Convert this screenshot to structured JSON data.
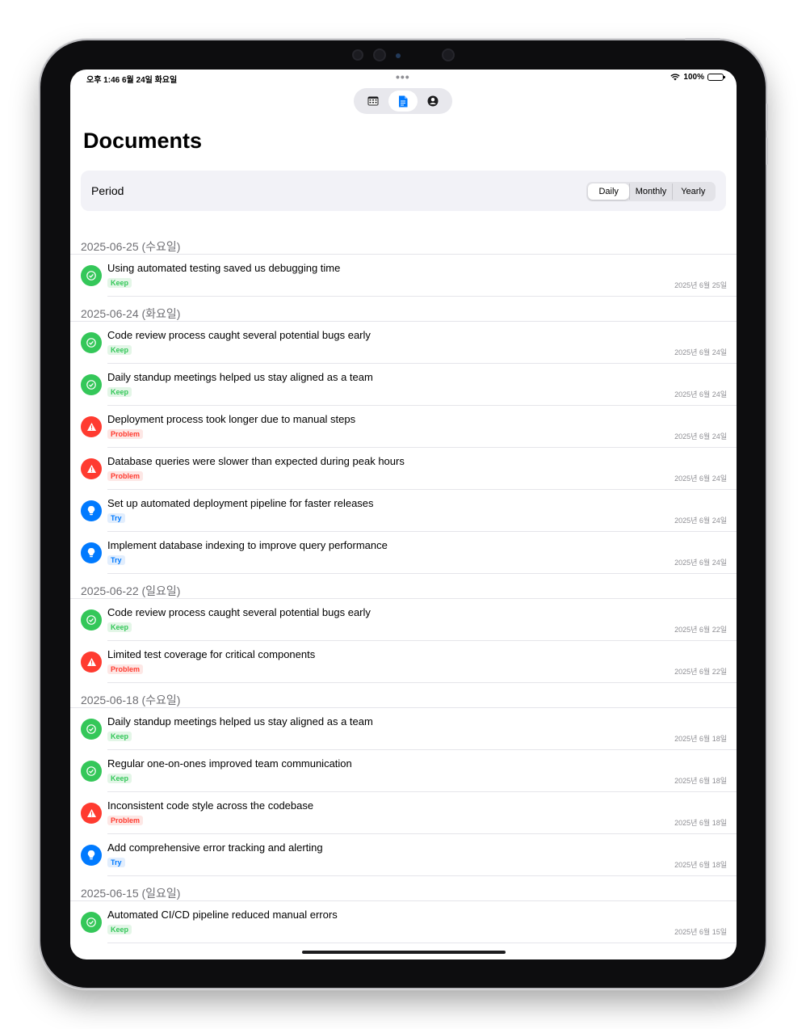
{
  "status": {
    "time": "오후 1:46   6월 24일 화요일",
    "battery": "100%"
  },
  "tabs": [
    {
      "name": "calendar",
      "icon": "calendar-icon",
      "active": false
    },
    {
      "name": "documents",
      "icon": "document-icon",
      "active": true
    },
    {
      "name": "profile",
      "icon": "person-icon",
      "active": false
    }
  ],
  "page_title": "Documents",
  "period": {
    "label": "Period",
    "options": [
      "Daily",
      "Monthly",
      "Yearly"
    ],
    "selected": "Daily"
  },
  "colors": {
    "keep": "#34c759",
    "problem": "#ff3b30",
    "try": "#007aff"
  },
  "sections": [
    {
      "header": "2025-06-25 (수요일)",
      "items": [
        {
          "text": "Using automated testing saved us debugging time",
          "tag": "Keep",
          "type": "keep",
          "date": "2025년 6월 25일"
        }
      ]
    },
    {
      "header": "2025-06-24 (화요일)",
      "items": [
        {
          "text": "Code review process caught several potential bugs early",
          "tag": "Keep",
          "type": "keep",
          "date": "2025년 6월 24일"
        },
        {
          "text": "Daily standup meetings helped us stay aligned as a team",
          "tag": "Keep",
          "type": "keep",
          "date": "2025년 6월 24일"
        },
        {
          "text": "Deployment process took longer due to manual steps",
          "tag": "Problem",
          "type": "problem",
          "date": "2025년 6월 24일"
        },
        {
          "text": "Database queries were slower than expected during peak hours",
          "tag": "Problem",
          "type": "problem",
          "date": "2025년 6월 24일"
        },
        {
          "text": "Set up automated deployment pipeline for faster releases",
          "tag": "Try",
          "type": "try",
          "date": "2025년 6월 24일"
        },
        {
          "text": "Implement database indexing to improve query performance",
          "tag": "Try",
          "type": "try",
          "date": "2025년 6월 24일"
        }
      ]
    },
    {
      "header": "2025-06-22 (일요일)",
      "items": [
        {
          "text": "Code review process caught several potential bugs early",
          "tag": "Keep",
          "type": "keep",
          "date": "2025년 6월 22일"
        },
        {
          "text": "Limited test coverage for critical components",
          "tag": "Problem",
          "type": "problem",
          "date": "2025년 6월 22일"
        }
      ]
    },
    {
      "header": "2025-06-18 (수요일)",
      "items": [
        {
          "text": "Daily standup meetings helped us stay aligned as a team",
          "tag": "Keep",
          "type": "keep",
          "date": "2025년 6월 18일"
        },
        {
          "text": "Regular one-on-ones improved team communication",
          "tag": "Keep",
          "type": "keep",
          "date": "2025년 6월 18일"
        },
        {
          "text": "Inconsistent code style across the codebase",
          "tag": "Problem",
          "type": "problem",
          "date": "2025년 6월 18일"
        },
        {
          "text": "Add comprehensive error tracking and alerting",
          "tag": "Try",
          "type": "try",
          "date": "2025년 6월 18일"
        }
      ]
    },
    {
      "header": "2025-06-15 (일요일)",
      "items": [
        {
          "text": "Automated CI/CD pipeline reduced manual errors",
          "tag": "Keep",
          "type": "keep",
          "date": "2025년 6월 15일"
        }
      ]
    }
  ]
}
